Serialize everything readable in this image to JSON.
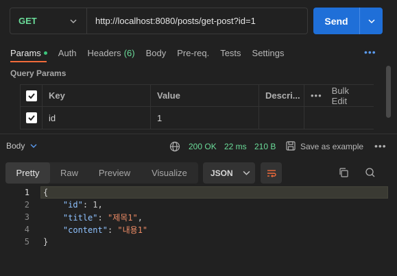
{
  "request": {
    "method": "GET",
    "url": "http://localhost:8080/posts/get-post?id=1",
    "send_label": "Send"
  },
  "tabs": [
    {
      "label": "Params",
      "active": true
    },
    {
      "label": "Auth"
    },
    {
      "label": "Headers",
      "count": "(6)"
    },
    {
      "label": "Body"
    },
    {
      "label": "Pre-req."
    },
    {
      "label": "Tests"
    },
    {
      "label": "Settings"
    }
  ],
  "query": {
    "title": "Query Params",
    "headers": {
      "key": "Key",
      "value": "Value",
      "desc": "Descri...",
      "bulk": "Bulk Edit"
    },
    "rows": [
      {
        "key": "id",
        "value": "1",
        "checked": true
      }
    ]
  },
  "response": {
    "body_label": "Body",
    "status": "200 OK",
    "time": "22 ms",
    "size": "210 B",
    "save_label": "Save as example",
    "views": [
      "Pretty",
      "Raw",
      "Preview",
      "Visualize"
    ],
    "active_view": "Pretty",
    "format": "JSON",
    "code_lines": [
      "1",
      "2",
      "3",
      "4",
      "5"
    ],
    "json": {
      "open": "{",
      "close": "}",
      "id_key": "\"id\"",
      "id_val": "1",
      "title_key": "\"title\"",
      "title_val": "\"제목1\"",
      "content_key": "\"content\"",
      "content_val": "\"내용1\""
    }
  },
  "colors": {
    "accent_orange": "#f26b3a",
    "send_blue": "#1f6fd8",
    "status_green": "#6bdd9a"
  }
}
